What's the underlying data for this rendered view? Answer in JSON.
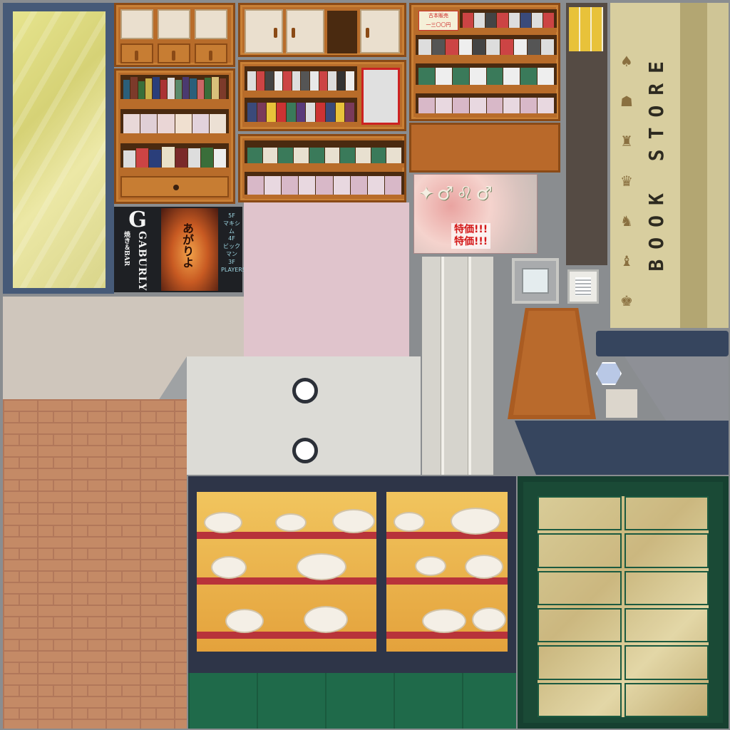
{
  "neon_sign": {
    "brand": "GABURLY",
    "subtitle": "焼き＆BAR",
    "lantern_text": "あがりよ",
    "directory": [
      "5F",
      "マキシム",
      "4F",
      "ビックマン",
      "3F",
      "PLAYERS"
    ]
  },
  "poster": {
    "symbols": "✦♂♌♂",
    "sale_line_1": "特価!!!",
    "sale_line_2": "特価!!!"
  },
  "book_store_sign": {
    "text": "BOOK STORE",
    "icon_glyphs": [
      "♠",
      "☗",
      "♜",
      "♛",
      "♞",
      "♝",
      "♚"
    ]
  },
  "shelf_labels": {
    "tag_top": "古本販売",
    "price_tag": "一三〇〇円"
  },
  "colors": {
    "wood": "#b86c2a",
    "neon": "#f4f4f4",
    "sale_red": "#d41818",
    "green_frame": "#1a4a36",
    "navy": "#36455e"
  }
}
